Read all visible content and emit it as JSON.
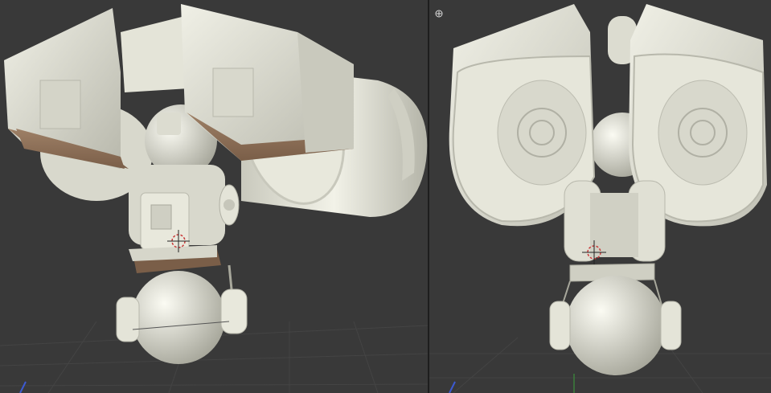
{
  "app": {
    "title": "",
    "accent_color": "#c83c3c",
    "background_color": "#393939",
    "model_color": "#e4e4d8"
  },
  "viewports": [
    {
      "id": "left",
      "view": "perspective-side",
      "gizmo": "axis-gizmo",
      "cursor": "3d-cursor-icon"
    },
    {
      "id": "right",
      "view": "perspective-front",
      "gizmo": "axis-gizmo",
      "cursor": "3d-cursor-icon",
      "corner_icon": "plus-circle-icon"
    }
  ]
}
